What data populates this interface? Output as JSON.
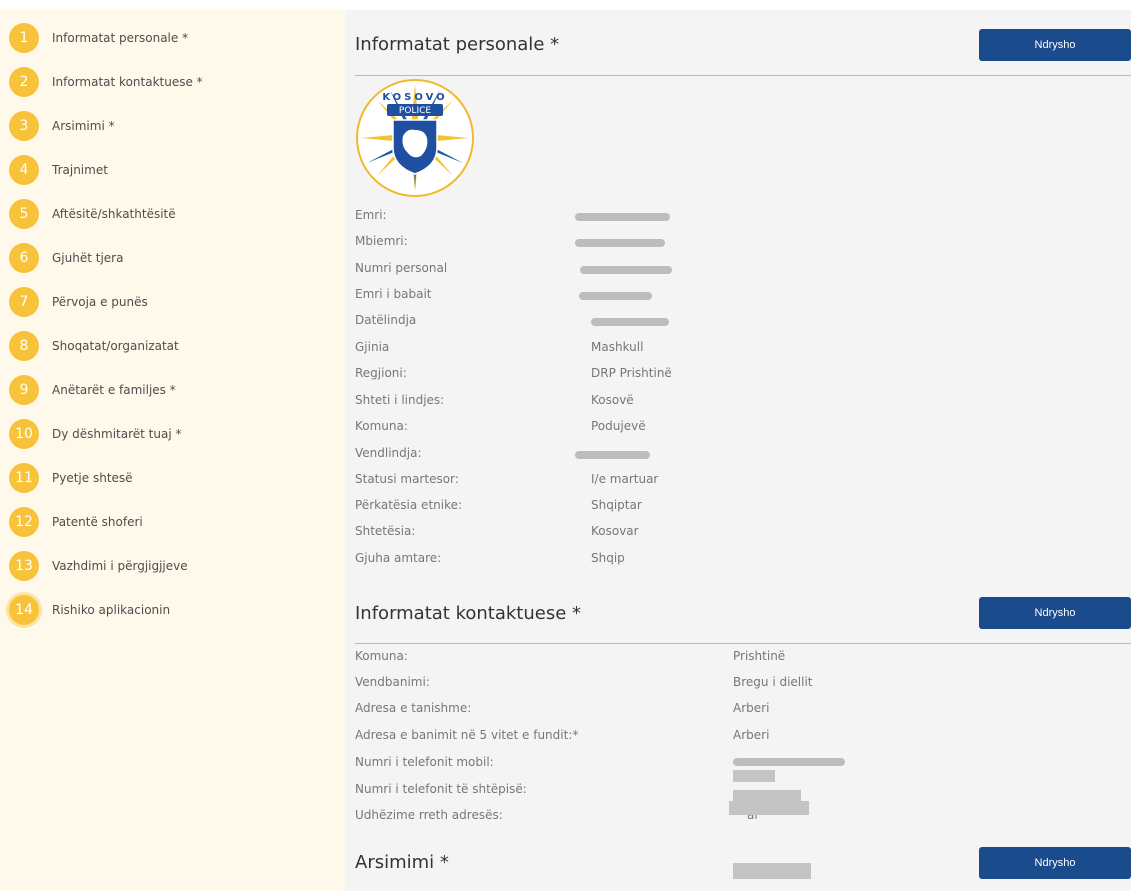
{
  "sidebar": {
    "steps": [
      {
        "num": "1",
        "label": "Informatat personale *"
      },
      {
        "num": "2",
        "label": "Informatat kontaktuese *"
      },
      {
        "num": "3",
        "label": "Arsimimi *"
      },
      {
        "num": "4",
        "label": "Trajnimet"
      },
      {
        "num": "5",
        "label": "Aftësitë/shkathtësitë"
      },
      {
        "num": "6",
        "label": "Gjuhët tjera"
      },
      {
        "num": "7",
        "label": "Përvoja e punës"
      },
      {
        "num": "8",
        "label": "Shoqatat/organizatat"
      },
      {
        "num": "9",
        "label": "Anëtarët e familjes *"
      },
      {
        "num": "10",
        "label": "Dy dëshmitarët tuaj *"
      },
      {
        "num": "11",
        "label": "Pyetje shtesë"
      },
      {
        "num": "12",
        "label": "Patentë shoferi"
      },
      {
        "num": "13",
        "label": "Vazhdimi i përgjigjjeve"
      },
      {
        "num": "14",
        "label": "Rishiko aplikacionin"
      }
    ],
    "active_step": "14"
  },
  "personal": {
    "title": "Informatat personale *",
    "edit_label": "Ndrysho",
    "logo": {
      "top_text": "KOSOVO",
      "band_text": "POLICE"
    },
    "fields": [
      {
        "label": "Emri:",
        "value": ""
      },
      {
        "label": "Mbiemri:",
        "value": ""
      },
      {
        "label": "Numri personal",
        "value": ""
      },
      {
        "label": "Emri i babait",
        "value": ""
      },
      {
        "label": "Datëlindja",
        "value": ""
      },
      {
        "label": "Gjinia",
        "value": "Mashkull"
      },
      {
        "label": "Regjioni:",
        "value": "DRP Prishtinë"
      },
      {
        "label": "Shteti i lindjes:",
        "value": "Kosovë"
      },
      {
        "label": "Komuna:",
        "value": "Podujevë"
      },
      {
        "label": "Vendlindja:",
        "value": ""
      },
      {
        "label": "Statusi martesor:",
        "value": "I/e martuar"
      },
      {
        "label": "Përkatësia etnike:",
        "value": "Shqiptar"
      },
      {
        "label": "Shtetësia:",
        "value": "Kosovar"
      },
      {
        "label": "Gjuha amtare:",
        "value": "Shqip"
      }
    ]
  },
  "contact": {
    "title": "Informatat kontaktuese *",
    "edit_label": "Ndrysho",
    "fields": [
      {
        "label": "Komuna:",
        "value": "Prishtinë"
      },
      {
        "label": "Vendbanimi:",
        "value": "Bregu i diellit"
      },
      {
        "label": "Adresa e tanishme:",
        "value": "Arberi"
      },
      {
        "label": "Adresa e banimit në 5 vitet e fundit:*",
        "value": "Arberi"
      },
      {
        "label": "Numri i telefonit mobil:",
        "value": ""
      },
      {
        "label": "Numri i telefonit të shtëpisë:",
        "value": ""
      },
      {
        "label": "Udhëzime rreth adresës:",
        "value": "ar"
      }
    ]
  },
  "education": {
    "title": "Arsimimi *",
    "edit_label": "Ndrysho"
  },
  "colors": {
    "accent": "#f7c33b",
    "button": "#1a4b8c",
    "sidebar_bg": "#fef9ea",
    "main_bg": "#f4f4f4"
  }
}
